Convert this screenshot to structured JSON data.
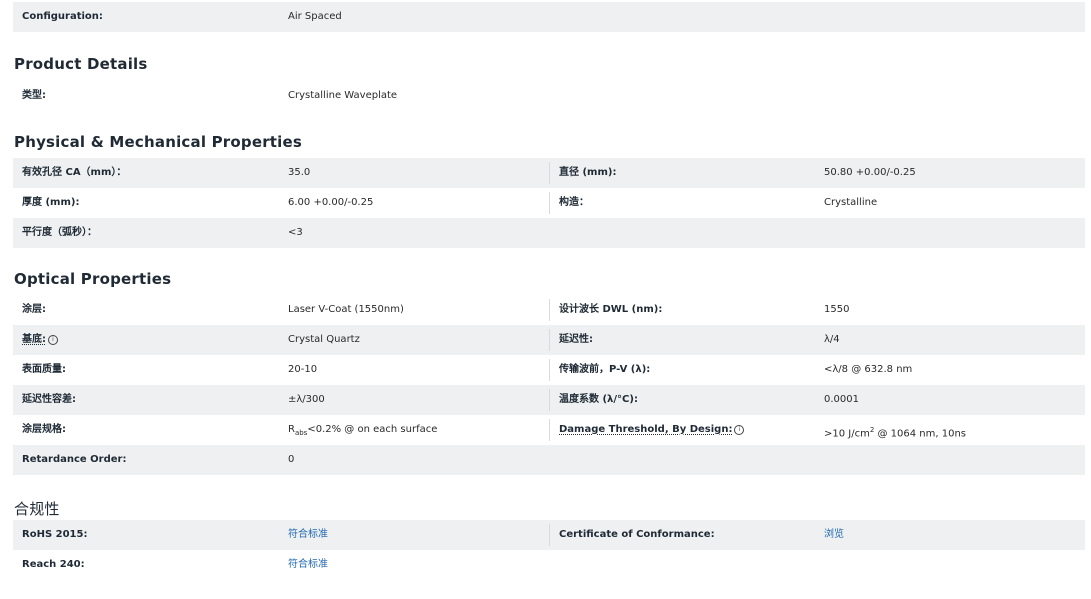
{
  "config": {
    "label": "Configuration:",
    "value": "Air Spaced"
  },
  "product_details": {
    "title": "Product Details",
    "rows": [
      {
        "label": "类型:",
        "value": "Crystalline Waveplate"
      }
    ]
  },
  "physical": {
    "title": "Physical & Mechanical Properties",
    "rows": [
      {
        "l1": "有效孔径 CA（mm）：",
        "v1": "35.0",
        "l2": "直径 (mm):",
        "v2": "50.80 +0.00/-0.25"
      },
      {
        "l1": "厚度 (mm):",
        "v1": "6.00 +0.00/-0.25",
        "l2": "构造：",
        "v2": "Crystalline"
      },
      {
        "l1": "平行度（弧秒）：",
        "v1": "<3"
      }
    ]
  },
  "optical": {
    "title": "Optical Properties",
    "rows": [
      {
        "l1": "涂层:",
        "v1": "Laser V-Coat (1550nm)",
        "l2": "设计波长 DWL (nm):",
        "v2": "1550"
      },
      {
        "l1": "基底:",
        "v1": "Crystal Quartz",
        "l2": "延迟性:",
        "v2": "λ/4"
      },
      {
        "l1": "表面质量:",
        "v1": "20-10",
        "l2": "传输波前，P-V (λ):",
        "v2": "<λ/8 @ 632.8 nm"
      },
      {
        "l1": "延迟性容差:",
        "v1": "±λ/300",
        "l2": "温度系数 (λ/°C):",
        "v2": "0.0001"
      },
      {
        "l1": "涂层规格:",
        "v1_r": "R",
        "v1_sub": "abs",
        "v1_rest": "<0.2% @ on each surface",
        "l2": "Damage Threshold, By Design:",
        "v2_pre": ">10 J/cm",
        "v2_sup": "2",
        "v2_rest": " @ 1064 nm, 10ns"
      },
      {
        "l1": "Retardance Order:",
        "v1": "0"
      }
    ],
    "info_glyph": "i"
  },
  "compliance": {
    "title": "合规性",
    "rows": [
      {
        "l1": "RoHS 2015:",
        "v1": "符合标准",
        "l2": "Certificate of Conformance:",
        "v2": "浏览"
      },
      {
        "l1": "Reach 240:",
        "v1": "符合标准"
      }
    ]
  },
  "colors": {
    "row_alt": "#eef0f1",
    "link": "#1f67b1",
    "heading": "#1f2a35"
  }
}
